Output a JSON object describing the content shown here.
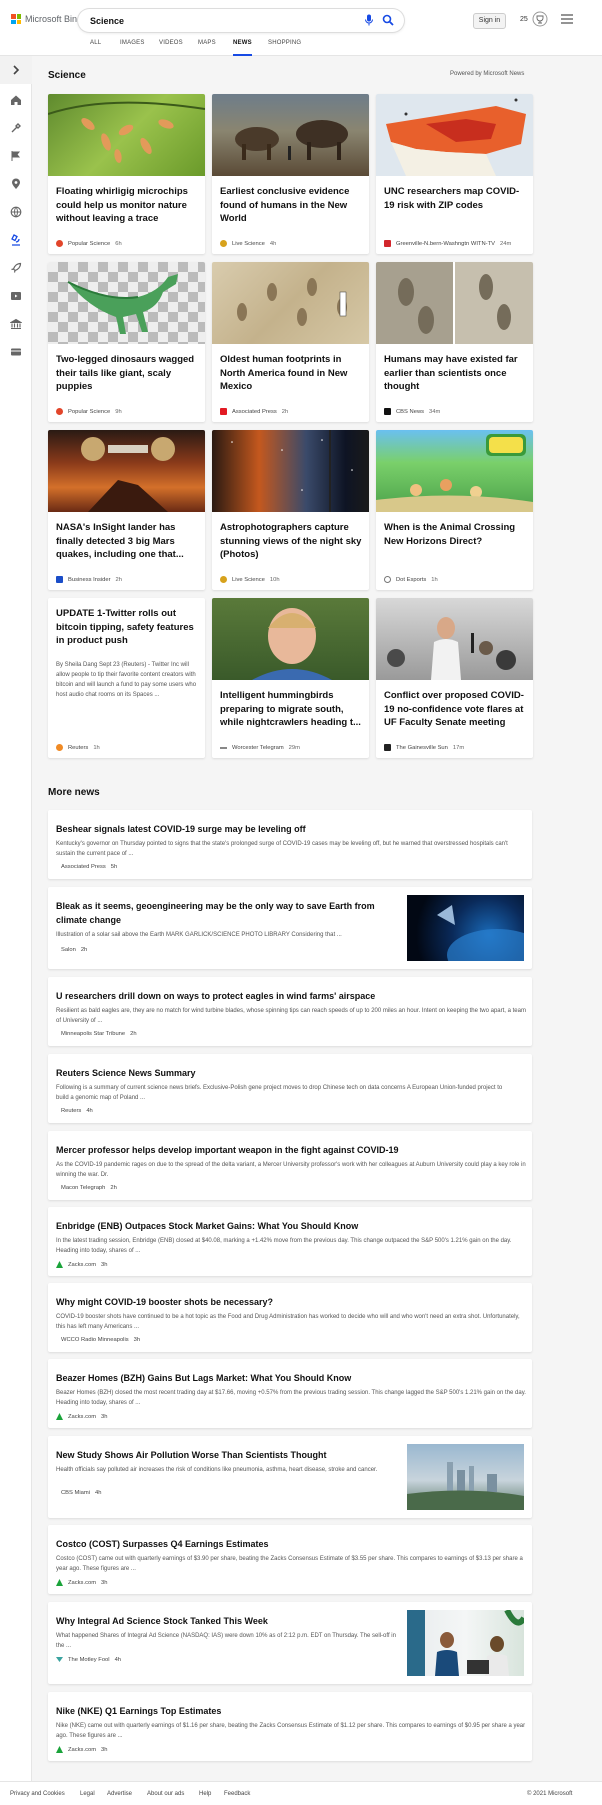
{
  "header": {
    "brand": "Microsoft Bing",
    "search_value": "Science",
    "signin_label": "Sign in",
    "rewards_count": "25"
  },
  "tabs": [
    {
      "label": "ALL",
      "active": false
    },
    {
      "label": "IMAGES",
      "active": false
    },
    {
      "label": "VIDEOS",
      "active": false
    },
    {
      "label": "MAPS",
      "active": false
    },
    {
      "label": "NEWS",
      "active": true
    },
    {
      "label": "SHOPPING",
      "active": false
    }
  ],
  "sidebar_icons": [
    "chevron-right-icon",
    "home-icon",
    "tools-icon",
    "flag-icon",
    "location-icon",
    "globe-icon",
    "microscope-icon",
    "rocket-icon",
    "video-icon",
    "bank-icon",
    "card-icon"
  ],
  "section": {
    "title": "Science",
    "powered_by": "Powered by Microsoft News"
  },
  "cards": [
    {
      "title": "Floating whirligig microchips could help us monitor nature without leaving a trace",
      "source": "Popular Science",
      "time": "6h",
      "icon": "popsci-icon",
      "color": "#e2452a"
    },
    {
      "title": "Earliest conclusive evidence found of humans in the New World",
      "source": "Live Science",
      "time": "4h",
      "icon": "livescience-icon",
      "color": "#d7a21c"
    },
    {
      "title": "UNC researchers map COVID-19 risk with ZIP codes",
      "source": "Greenville-N.bern-Washngtn WITN-TV",
      "time": "24m",
      "icon": "witn-icon",
      "color": "#d2262c"
    },
    {
      "title": "Two-legged dinosaurs wagged their tails like giant, scaly puppies",
      "source": "Popular Science",
      "time": "9h",
      "icon": "popsci-icon",
      "color": "#e2452a"
    },
    {
      "title": "Oldest human footprints in North America found in New Mexico",
      "source": "Associated Press",
      "time": "2h",
      "icon": "ap-icon",
      "color": "#e21a23"
    },
    {
      "title": "Humans may have existed far earlier than scientists once thought",
      "source": "CBS News",
      "time": "34m",
      "icon": "cbs-icon",
      "color": "#111111"
    },
    {
      "title": "NASA's InSight lander has finally detected 3 big Mars quakes, including one that...",
      "source": "Business Insider",
      "time": "2h",
      "icon": "bi-icon",
      "color": "#1a4dc8"
    },
    {
      "title": "Astrophotographers capture stunning views of the night sky (Photos)",
      "source": "Live Science",
      "time": "10h",
      "icon": "livescience-icon",
      "color": "#d7a21c"
    },
    {
      "title": "When is the Animal Crossing New Horizons Direct?",
      "source": "Dot Esports",
      "time": "1h",
      "icon": "dotesports-icon",
      "color": "#777777"
    },
    {
      "title": "UPDATE 1-Twitter rolls out bitcoin tipping, safety features in product push",
      "desc": "By Sheila Dang Sept 23 (Reuters) - Twitter Inc will allow people to tip their favorite content creators with bitcoin and will launch a fund to pay some users who host audio chat rooms on its Spaces ...",
      "source": "Reuters",
      "time": "1h",
      "icon": "reuters-icon",
      "color": "#f08a24"
    },
    {
      "title": "Intelligent hummingbirds preparing to migrate south, while nightcrawlers heading t...",
      "source": "Worcester Telegram",
      "time": "29m",
      "icon": "telegram-icon",
      "color": "#888888"
    },
    {
      "title": "Conflict over proposed COVID-19 no-confidence vote flares at UF Faculty Senate meeting",
      "source": "The Gainesville Sun",
      "time": "17m",
      "icon": "gainesvillesun-icon",
      "color": "#222222"
    }
  ],
  "more_news": {
    "title": "More news",
    "items": [
      {
        "title": "Beshear signals latest COVID-19 surge may be leveling off",
        "desc": "Kentucky's governor on Thursday pointed to signs that the state's prolonged surge of COVID-19 cases may be leveling off, but he warned that overstressed hospitals can't sustain the current pace of ...",
        "source": "Associated Press",
        "time": "5h",
        "icon": "ap-icon",
        "color": "#e21a23"
      },
      {
        "title": "Bleak as it seems, geoengineering may be the only way to save Earth from climate change",
        "desc": "Illustration of a solar sail above the Earth MARK GARLICK/SCIENCE PHOTO LIBRARY Considering that ...",
        "source": "Salon",
        "time": "2h",
        "icon": "salon-icon",
        "color": "#c4151c"
      },
      {
        "title": "U researchers drill down on ways to protect eagles in wind farms' airspace",
        "desc": "Resilient as bald eagles are, they are no match for wind turbine blades, whose spinning tips can reach speeds of up to 200 miles an hour. Intent on keeping the two apart, a team of University of ...",
        "source": "Minneapolis Star Tribune",
        "time": "2h",
        "icon": "startribune-icon",
        "color": "#2a9a3a"
      },
      {
        "title": "Reuters Science News Summary",
        "desc": "Following is a summary of current science news briefs. Exclusive-Polish gene project moves to drop Chinese tech on data concerns A European Union-funded project to build a genomic map of Poland ...",
        "source": "Reuters",
        "time": "4h",
        "icon": "reuters-icon",
        "color": "#f08a24"
      },
      {
        "title": "Mercer professor helps develop important weapon in the fight against COVID-19",
        "desc": "As the COVID-19 pandemic rages on due to the spread of the delta variant, a Mercer University professor's work with her colleagues at Auburn University could play a key role in winning the war. Dr.",
        "source": "Macon Telegraph",
        "time": "2h",
        "icon": "macon-icon",
        "color": "#1a3a7a"
      },
      {
        "title": "Enbridge (ENB) Outpaces Stock Market Gains: What You Should Know",
        "desc": "In the latest trading session, Enbridge (ENB) closed at $40.08, marking a +1.42% move from the previous day. This change outpaced the S&P 500's 1.21% gain on the day. Heading into today, shares of ...",
        "source": "Zacks.com",
        "time": "3h",
        "icon": "zacks-icon",
        "color": "#1aa33a"
      },
      {
        "title": "Why might COVID-19 booster shots be necessary?",
        "desc": "COVID-19 booster shots have continued to be a hot topic as the Food and Drug Administration has worked to decide who will and who won't need an extra shot. Unfortunately, this has left many Americans ...",
        "source": "WCCO Radio Minneapolis",
        "time": "3h",
        "icon": "wcco-icon",
        "color": "#e04020"
      },
      {
        "title": "Beazer Homes (BZH) Gains But Lags Market: What You Should Know",
        "desc": "Beazer Homes (BZH) closed the most recent trading day at $17.66, moving +0.57% from the previous trading session. This change lagged the S&P 500's 1.21% gain on the day. Heading into today, shares of ...",
        "source": "Zacks.com",
        "time": "3h",
        "icon": "zacks-icon",
        "color": "#1aa33a"
      },
      {
        "title": "New Study Shows Air Pollution Worse Than Scientists Thought",
        "desc": "Health officials say polluted air increases the risk of conditions like pneumonia, asthma, heart disease, stroke and cancer.",
        "source": "CBS Miami",
        "time": "4h",
        "icon": "cbs-icon",
        "color": "#1a4dc8"
      },
      {
        "title": "Costco (COST) Surpasses Q4 Earnings Estimates",
        "desc": "Costco (COST) came out with quarterly earnings of $3.90 per share, beating the Zacks Consensus Estimate of $3.55 per share. This compares to earnings of $3.13 per share a year ago. These figures are ...",
        "source": "Zacks.com",
        "time": "3h",
        "icon": "zacks-icon",
        "color": "#1aa33a"
      },
      {
        "title": "Why Integral Ad Science Stock Tanked This Week",
        "desc": "What happened Shares of Integral Ad Science (NASDAQ: IAS) were down 10% as of 2:12 p.m. EDT on Thursday. The sell-off in the ...",
        "source": "The Motley Fool",
        "time": "4h",
        "icon": "motleyfool-icon",
        "color": "#3aa3a0"
      },
      {
        "title": "Nike (NKE) Q1 Earnings Top Estimates",
        "desc": "Nike (NKE) came out with quarterly earnings of $1.16 per share, beating the Zacks Consensus Estimate of $1.12 per share. This compares to earnings of $0.95 per share a year ago. These figures are ...",
        "source": "Zacks.com",
        "time": "3h",
        "icon": "zacks-icon",
        "color": "#1aa33a"
      }
    ]
  },
  "footer": {
    "links": [
      "Privacy and Cookies",
      "Legal",
      "Advertise",
      "About our ads",
      "Help",
      "Feedback"
    ],
    "copyright": "© 2021 Microsoft"
  }
}
